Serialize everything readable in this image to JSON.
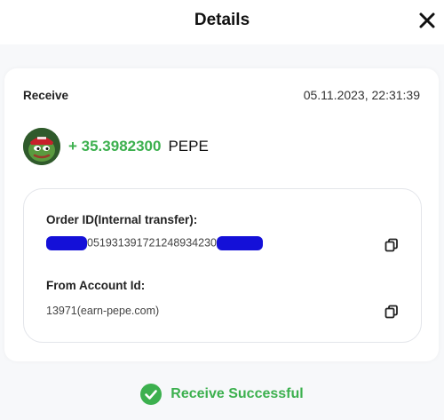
{
  "header": {
    "title": "Details",
    "close_icon": "close-icon"
  },
  "transaction": {
    "type": "Receive",
    "datetime": "05.11.2023, 22:31:39",
    "amount": "+ 35.3982300",
    "currency": "PEPE",
    "token_icon": "pepe-token-avatar"
  },
  "details": {
    "order_id_label": "Order ID(Internal transfer):",
    "order_id_value": "051931391721248934230",
    "from_account_label": "From Account Id:",
    "from_account_value": "13971(earn-pepe.com)",
    "copy_icon": "copy-icon"
  },
  "status": {
    "text": "Receive Successful",
    "icon": "check-circle-icon"
  },
  "colors": {
    "success_green": "#3cb04e",
    "redaction_blue": "#1410d8"
  }
}
